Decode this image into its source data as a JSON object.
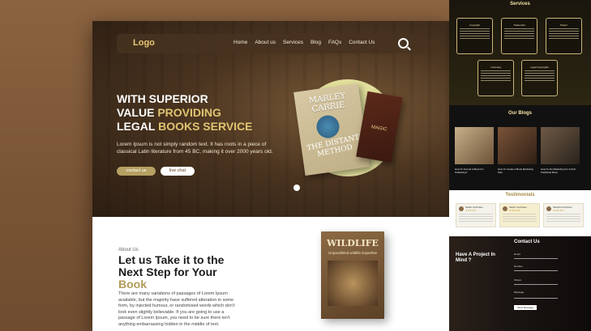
{
  "nav": {
    "logo": "Logo",
    "links": [
      "Home",
      "About us",
      "Services",
      "Blog",
      "FAQs",
      "Contact Us"
    ]
  },
  "hero": {
    "line1": "WITH SUPERIOR",
    "line2a": "VALUE ",
    "line2b": "PROVIDING",
    "line3a": "LEGAL ",
    "line3b": "BOOKS SERVICE",
    "lead": "Lorem Ipsum is not simply random text. It has roots in a piece of classical Latin literature from 45 BC, making it over 2000 years old.",
    "btn_primary": "contact us",
    "btn_secondary": "live chat",
    "book1_author": "MARLEY CARRIE",
    "book1_title": "THE DISTANT METHOD",
    "book2_title": "MAGIC"
  },
  "about": {
    "tag": "About Us",
    "h1": "Let us Take it to the",
    "h2": "Next Step  for Your",
    "h3": "Book",
    "p": "There are many variations of passages of Lorem Ipsum available, but the majority have suffered alteration in some form, by injected humour, or randomised words which don't look even slightly believable. If you are going to use a passage of Lorem Ipsum, you need to be sure there isn't anything embarrassing hidden in the middle of text.",
    "book_title": "WILDLIFE",
    "book_sub": "Unparalleled wildlife Expertise"
  },
  "services": {
    "title": "Services",
    "cards": [
      "Copyright",
      "Trademark",
      "Patent",
      "Licensing",
      "Legal Copyrights"
    ]
  },
  "blogs": {
    "title": "Our Blogs",
    "items": [
      "How To Format A Book For Publishing?",
      "How To Create A Book Marketing Plan",
      "How To Do Marketing For A Self-Published Book"
    ]
  },
  "testimonials": {
    "title": "Testimonials",
    "names": [
      "Sarah Cochrane",
      "Sarah Cochrane",
      "Sandra Cochrane"
    ]
  },
  "contact": {
    "heading": "Have A Project In Mind ?",
    "title": "Contact Us",
    "fields": [
      "Email",
      "Number",
      "Others",
      "Message"
    ],
    "send": "Send Message"
  }
}
